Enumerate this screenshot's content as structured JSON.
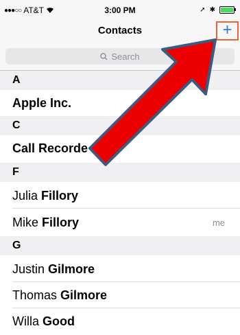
{
  "status_bar": {
    "carrier": "AT&T",
    "time": "3:00 PM"
  },
  "nav": {
    "title": "Contacts",
    "add_label": "+"
  },
  "search": {
    "placeholder": "Search"
  },
  "sections": [
    {
      "letter": "A",
      "contacts": [
        {
          "first": "Apple Inc.",
          "last": ""
        }
      ]
    },
    {
      "letter": "C",
      "contacts": [
        {
          "first": "Call Recorde",
          "last": ""
        }
      ]
    },
    {
      "letter": "F",
      "contacts": [
        {
          "first": "Julia ",
          "last": "Fillory"
        },
        {
          "first": "Mike ",
          "last": "Fillory",
          "badge": "me"
        }
      ]
    },
    {
      "letter": "G",
      "contacts": [
        {
          "first": "Justin ",
          "last": "Gilmore"
        },
        {
          "first": "Thomas ",
          "last": "Gilmore"
        },
        {
          "first": "Willa ",
          "last": "Good"
        }
      ]
    }
  ],
  "colors": {
    "accent": "#2a7ae2",
    "highlight_box": "#e8653c",
    "arrow_fill": "#ee0000",
    "arrow_stroke": "#3d5a80"
  }
}
